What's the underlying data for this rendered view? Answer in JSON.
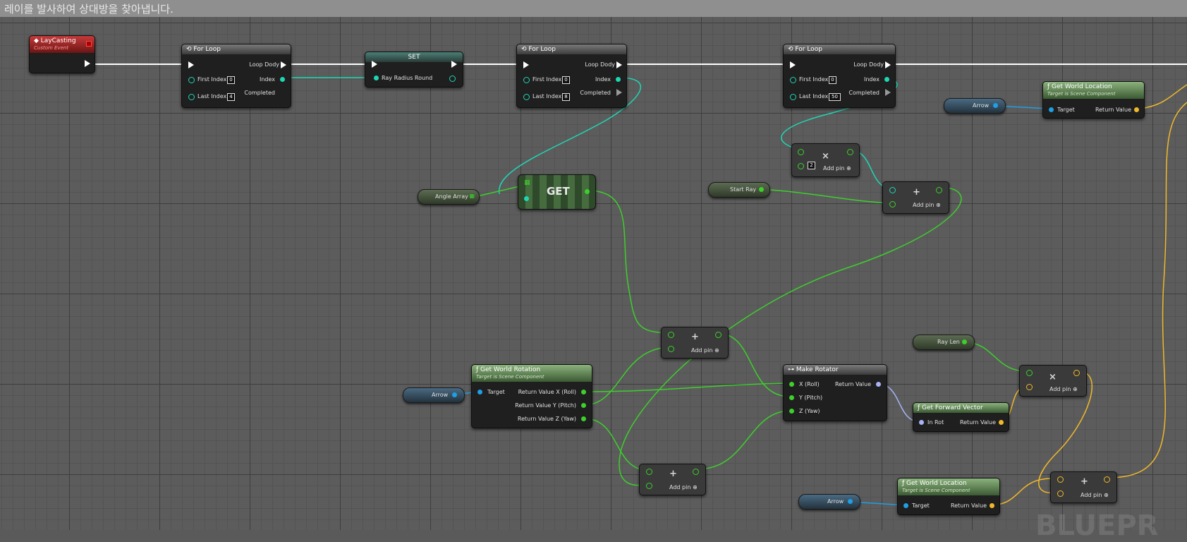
{
  "title_bar": {
    "text": "레이를 발사하여 상대방을 찾아냅니다."
  },
  "nodes": {
    "event": {
      "title": "LayCasting",
      "subtitle": "Custom Event"
    },
    "for1": {
      "title": "For Loop",
      "loop_body": "Loop Dody",
      "first_index": "First Index",
      "first_value": "0",
      "last_index": "Last Index",
      "last_value": "4",
      "index": "Index",
      "completed": "Completed"
    },
    "set": {
      "title": "SET",
      "pin": "Ray Radius Round"
    },
    "for2": {
      "title": "For Loop",
      "loop_body": "Loop Dody",
      "first_index": "First Index",
      "first_value": "0",
      "last_index": "Last Index",
      "last_value": "8",
      "index": "Index",
      "completed": "Completed"
    },
    "for3": {
      "title": "For Loop",
      "loop_body": "Loop Dody",
      "first_index": "First Index",
      "first_value": "0",
      "last_index": "Last Index",
      "last_value": "50",
      "index": "Index",
      "completed": "Completed"
    },
    "angle_array": {
      "label": "Angle Array"
    },
    "get": {
      "label": "GET"
    },
    "start_ray": {
      "label": "Start Ray"
    },
    "mult1": {
      "op": "×",
      "value": "2",
      "add_pin": "Add pin"
    },
    "add1": {
      "op": "+",
      "add_pin": "Add pin"
    },
    "arrow1": {
      "label": "Arrow"
    },
    "gwl1": {
      "title": "Get World Location",
      "subtitle": "Target is Scene Component",
      "target": "Target",
      "return": "Return Value"
    },
    "add2": {
      "op": "+",
      "add_pin": "Add pin"
    },
    "arrow2": {
      "label": "Arrow"
    },
    "gwr": {
      "title": "Get World Rotation",
      "subtitle": "Target is Scene Component",
      "target": "Target",
      "rx": "Return Value X (Roll)",
      "ry": "Return Value Y (Pitch)",
      "rz": "Return Value Z (Yaw)"
    },
    "make_rot": {
      "title": "Make Rotator",
      "x": "X (Roll)",
      "y": "Y (Pitch)",
      "z": "Z (Yaw)",
      "return": "Return Value"
    },
    "ray_len": {
      "label": "Ray Len"
    },
    "gfv": {
      "title": "Get Forward Vector",
      "in": "In Rot",
      "return": "Return Value"
    },
    "mult2": {
      "op": "×",
      "add_pin": "Add pin"
    },
    "add3": {
      "op": "+",
      "add_pin": "Add pin"
    },
    "arrow3": {
      "label": "Arrow"
    },
    "gwl2": {
      "title": "Get World Location",
      "subtitle": "Target is Scene Component",
      "target": "Target",
      "return": "Return Value"
    },
    "add4": {
      "op": "+",
      "add_pin": "Add pin"
    }
  },
  "watermark": "BLUEPR",
  "colors": {
    "exec": "#ffffff",
    "int": "#1fd6b4",
    "float": "#3dcf2c",
    "vector": "#f0b92a",
    "rotator": "#a6b4f5",
    "object": "#1e9fe6"
  }
}
